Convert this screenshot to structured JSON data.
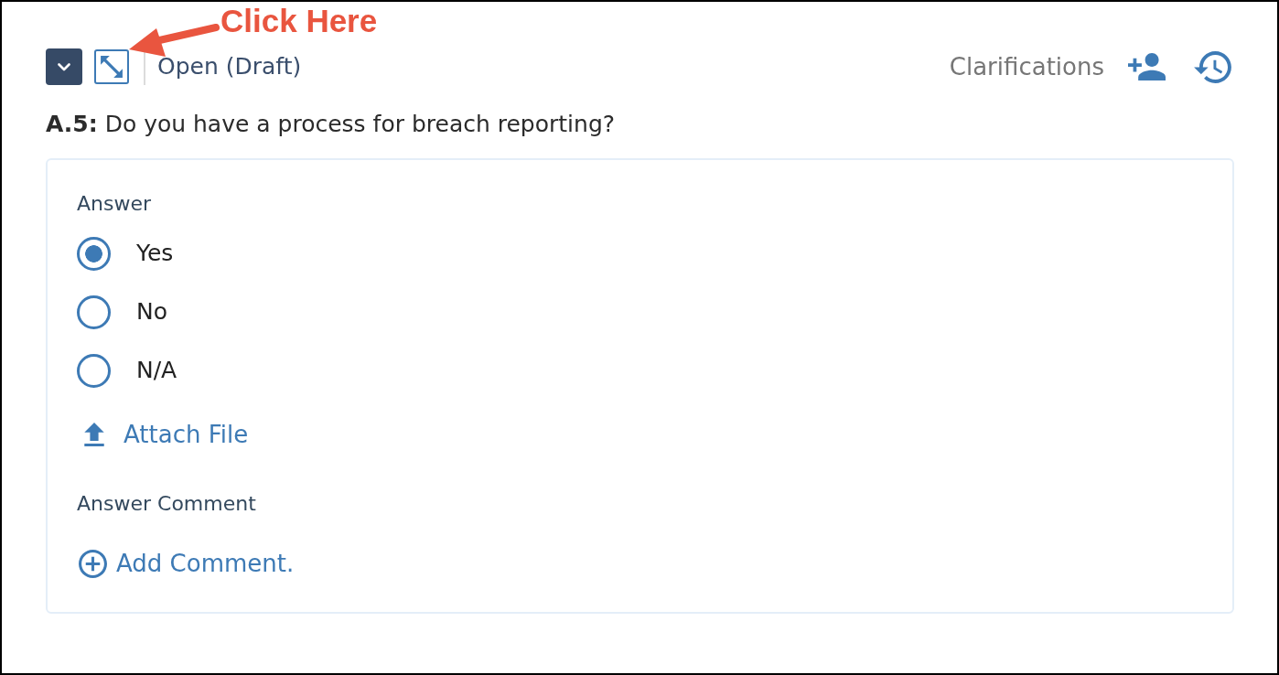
{
  "annotation": {
    "text": "Click Here"
  },
  "header": {
    "status": "Open (Draft)",
    "clarifications": "Clarifications"
  },
  "question": {
    "text": "**A.5:** Do you have a process for breach reporting?"
  },
  "answer": {
    "label": "Answer",
    "options": [
      {
        "label": "Yes",
        "selected": true
      },
      {
        "label": "No",
        "selected": false
      },
      {
        "label": "N/A",
        "selected": false
      }
    ],
    "attach_file": "Attach File"
  },
  "comment": {
    "label": "Answer Comment",
    "add_comment": "Add Comment."
  }
}
